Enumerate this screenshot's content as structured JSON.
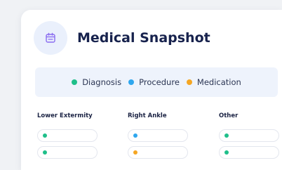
{
  "title": "Medical Snapshot",
  "icon": "calendar-icon",
  "colors": {
    "diagnosis": "#1fbf8a",
    "procedure": "#2fa7ee",
    "medication": "#f5a623",
    "icon": "#8a6cf0",
    "title": "#17224d"
  },
  "legend": [
    {
      "label": "Diagnosis",
      "color": "#1fbf8a"
    },
    {
      "label": "Procedure",
      "color": "#2fa7ee"
    },
    {
      "label": "Medication",
      "color": "#f5a623"
    }
  ],
  "columns": [
    {
      "title": "Lower Extermity",
      "items": [
        "diagnosis",
        "diagnosis"
      ]
    },
    {
      "title": "Right Ankle",
      "items": [
        "procedure",
        "medication"
      ]
    },
    {
      "title": "Other",
      "items": [
        "diagnosis",
        "diagnosis"
      ]
    }
  ]
}
